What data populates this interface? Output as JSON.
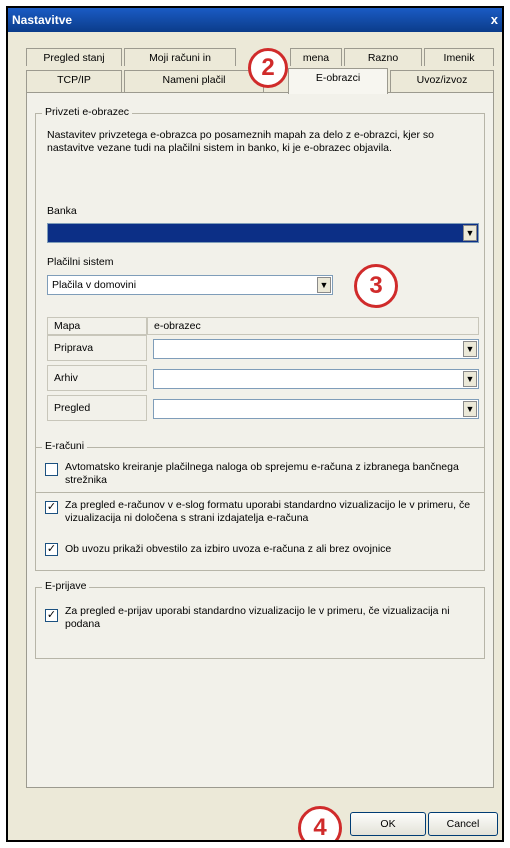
{
  "window": {
    "title": "Nastavitve",
    "close_label": "x"
  },
  "tabs_row1": [
    "Pregled stanj",
    "Moji računi in",
    "mena",
    "Razno",
    "Imenik"
  ],
  "tabs_row2": [
    "TCP/IP",
    "Nameni plačil",
    "E-obrazci",
    "Uvoz/izvoz"
  ],
  "group_receive": {
    "legend": "Privzeti e-obrazec",
    "description": "Nastavitev privzetega e-obrazca po posameznih mapah za delo z e-obrazci, kjer so nastavitve vezane tudi na plačilni sistem in banko, ki je e-obrazec objavila.",
    "bank_label": "Banka",
    "bank_value": "",
    "payment_label": "Plačilni sistem",
    "payment_value": "Plačila v domovini",
    "grid_header": [
      "Mapa",
      "e-obrazec"
    ],
    "grid_rows": [
      "Priprava",
      "Arhiv",
      "Pregled"
    ]
  },
  "group_einvoices": {
    "legend": "E-računi",
    "options": [
      {
        "label": "Avtomatsko kreiranje plačilnega naloga ob sprejemu e-računa z izbranega bančnega strežnika",
        "checked": false
      },
      {
        "label": "Za pregled e-računov v e-slog formatu uporabi standardno vizualizacijo le v primeru, če vizualizacija ni določena s strani izdajatelja e-računa",
        "checked": true
      },
      {
        "label": "Ob uvozu prikaži obvestilo za izbiro uvoza e-računa z ali brez ovojnice",
        "checked": true
      }
    ]
  },
  "group_eapplications": {
    "legend": "E-prijave",
    "options": [
      {
        "label": "Za pregled e-prijav uporabi standardno vizualizacijo le v primeru, če vizualizacija ni podana",
        "checked": true
      }
    ]
  },
  "markers": [
    "2",
    "3",
    "4"
  ],
  "buttons": {
    "ok": "OK",
    "cancel": "Cancel"
  },
  "icons": {
    "dropdown": "chevron-down-icon",
    "check": "checkmark-icon"
  },
  "colors": {
    "titlebar": "#0b3c8a",
    "marker": "#d02b2b",
    "selected": "#0c2f86"
  }
}
